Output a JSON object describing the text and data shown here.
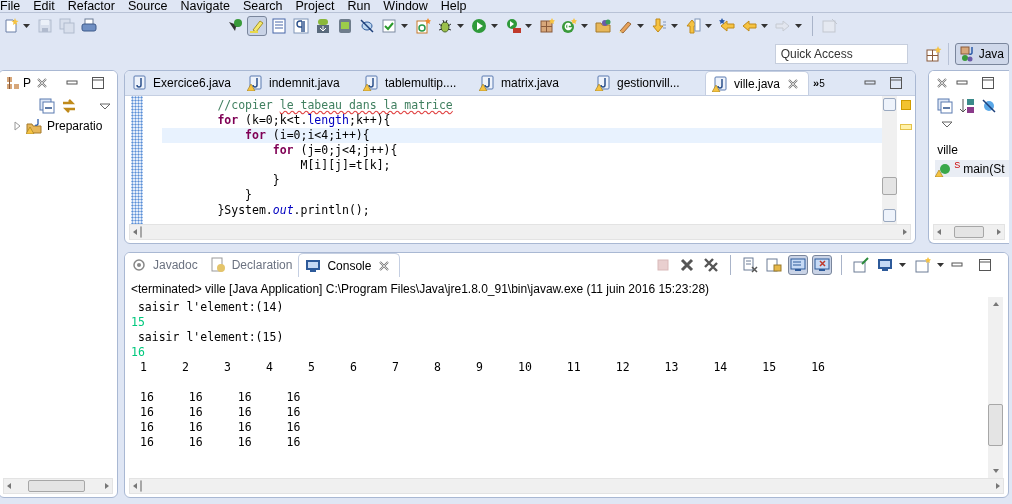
{
  "menu": [
    "File",
    "Edit",
    "Refactor",
    "Source",
    "Navigate",
    "Search",
    "Project",
    "Run",
    "Window",
    "Help"
  ],
  "toolbar": [
    {
      "pressed": false,
      "disabled": false,
      "dropdown": true
    },
    {
      "pressed": false,
      "disabled": true,
      "dropdown": false
    },
    {
      "pressed": false,
      "disabled": true,
      "dropdown": false
    },
    {
      "pressed": false,
      "disabled": false,
      "dropdown": false
    },
    {
      "pressed": false,
      "disabled": false,
      "dropdown": false
    },
    {
      "pressed": true,
      "disabled": false,
      "dropdown": false
    },
    {
      "pressed": false,
      "disabled": false,
      "dropdown": false
    },
    {
      "pressed": false,
      "disabled": false,
      "dropdown": false
    },
    {
      "pressed": false,
      "disabled": false,
      "dropdown": false
    },
    {
      "pressed": false,
      "disabled": false,
      "dropdown": false
    },
    {
      "pressed": false,
      "disabled": false,
      "dropdown": false
    },
    {
      "pressed": false,
      "disabled": false,
      "dropdown": true
    },
    {
      "pressed": false,
      "disabled": false,
      "dropdown": false
    },
    {
      "pressed": false,
      "disabled": false,
      "dropdown": true
    },
    {
      "pressed": false,
      "disabled": false,
      "dropdown": true
    },
    {
      "pressed": false,
      "disabled": false,
      "dropdown": true
    },
    {
      "pressed": false,
      "disabled": false,
      "dropdown": false
    },
    {
      "pressed": false,
      "disabled": false,
      "dropdown": true
    },
    {
      "pressed": false,
      "disabled": false,
      "dropdown": false
    },
    {
      "pressed": false,
      "disabled": false,
      "dropdown": true
    },
    {
      "pressed": false,
      "disabled": false,
      "dropdown": true
    },
    {
      "pressed": false,
      "disabled": false,
      "dropdown": true
    },
    {
      "pressed": false,
      "disabled": false,
      "dropdown": false
    },
    {
      "pressed": false,
      "disabled": false,
      "dropdown": true
    },
    {
      "pressed": false,
      "disabled": true,
      "dropdown": true
    },
    {
      "pressed": false,
      "disabled": true,
      "dropdown": false
    }
  ],
  "quick_access": {
    "placeholder": "Quick Access"
  },
  "perspective": {
    "label": "Java",
    "selected": true
  },
  "package_explorer": {
    "tab": "P",
    "items": [
      {
        "label": "Preparatio",
        "expanded": false,
        "warning": true
      }
    ]
  },
  "editor": {
    "tabs": [
      {
        "label": "Exercice6.java",
        "selected": false,
        "warning": false
      },
      {
        "label": "indemnit.java",
        "selected": false,
        "warning": true
      },
      {
        "label": "tablemultip....",
        "selected": false,
        "warning": true
      },
      {
        "label": "matrix.java",
        "selected": false,
        "warning": true
      },
      {
        "label": "gestionvill...",
        "selected": false,
        "warning": true
      },
      {
        "label": "ville.java",
        "selected": true,
        "warning": true
      }
    ],
    "overflow": {
      "symbol": "»",
      "count": "5"
    },
    "lines": [
      {
        "current": false,
        "tokens": [
          {
            "text": "        //copier ",
            "kind": "comment"
          },
          {
            "text": "le tabeau dans la matrice",
            "kind": "misspelled"
          }
        ]
      },
      {
        "current": false,
        "tokens": [
          {
            "text": "        for",
            "kind": "keyword"
          },
          {
            "text": " (k=0;k<t.",
            "kind": "plain"
          },
          {
            "text": "length",
            "kind": "field"
          },
          {
            "text": ";k++){",
            "kind": "plain"
          }
        ]
      },
      {
        "current": true,
        "tokens": [
          {
            "text": "            for",
            "kind": "keyword"
          },
          {
            "text": " (i=0;i<4;i++){",
            "kind": "plain"
          }
        ]
      },
      {
        "current": false,
        "tokens": [
          {
            "text": "                for",
            "kind": "keyword"
          },
          {
            "text": " (j=0;j<4;j++){",
            "kind": "plain"
          }
        ]
      },
      {
        "current": false,
        "tokens": [
          {
            "text": "                    M[i][j]=t[k];",
            "kind": "plain"
          }
        ]
      },
      {
        "current": false,
        "tokens": [
          {
            "text": "                }",
            "kind": "plain"
          }
        ]
      },
      {
        "current": false,
        "tokens": [
          {
            "text": "            }",
            "kind": "plain"
          }
        ]
      },
      {
        "current": false,
        "tokens": [
          {
            "text": "        }System.",
            "kind": "plain"
          },
          {
            "text": "out",
            "kind": "static-field"
          },
          {
            "text": ".println();",
            "kind": "plain"
          }
        ]
      }
    ]
  },
  "outline": {
    "title": "ville",
    "items": [
      {
        "label": "main(St",
        "modifier": "S",
        "warning": true
      }
    ]
  },
  "console": {
    "tabs": [
      {
        "label": "Javadoc",
        "selected": false
      },
      {
        "label": "Declaration",
        "selected": false
      },
      {
        "label": "Console",
        "selected": true
      }
    ],
    "toolbar": [
      {
        "pressed": false,
        "disabled": true,
        "dropdown": false
      },
      {
        "pressed": false,
        "disabled": false,
        "dropdown": false
      },
      {
        "pressed": false,
        "disabled": false,
        "dropdown": false
      },
      {
        "pressed": false,
        "disabled": false,
        "dropdown": false
      },
      {
        "pressed": false,
        "disabled": false,
        "dropdown": false
      },
      {
        "pressed": true,
        "disabled": false,
        "dropdown": false
      },
      {
        "pressed": true,
        "disabled": false,
        "dropdown": false
      },
      {
        "pressed": false,
        "disabled": false,
        "dropdown": false
      },
      {
        "pressed": false,
        "disabled": false,
        "dropdown": true
      },
      {
        "pressed": false,
        "disabled": false,
        "dropdown": true
      }
    ],
    "header": "<terminated> ville [Java Application] C:\\Program Files\\Java\\jre1.8.0_91\\bin\\javaw.exe (11 juin 2016 15:23:28)",
    "lines": [
      {
        "kind": "output",
        "text": " saisir l'element:(14)"
      },
      {
        "kind": "input",
        "text": "15"
      },
      {
        "kind": "output",
        "text": " saisir l'element:(15)"
      },
      {
        "kind": "input",
        "text": "16"
      },
      {
        "kind": "row",
        "cells": [
          "1",
          "2",
          "3",
          "4",
          "5",
          "6",
          "7",
          "8",
          "9",
          "10",
          "11",
          "12",
          "13",
          "14",
          "15",
          "16"
        ]
      },
      {
        "kind": "blank"
      },
      {
        "kind": "row",
        "cells": [
          "16",
          "16",
          "16",
          "16"
        ]
      },
      {
        "kind": "row",
        "cells": [
          "16",
          "16",
          "16",
          "16"
        ]
      },
      {
        "kind": "row",
        "cells": [
          "16",
          "16",
          "16",
          "16"
        ]
      },
      {
        "kind": "row",
        "cells": [
          "16",
          "16",
          "16",
          "16"
        ]
      }
    ]
  }
}
